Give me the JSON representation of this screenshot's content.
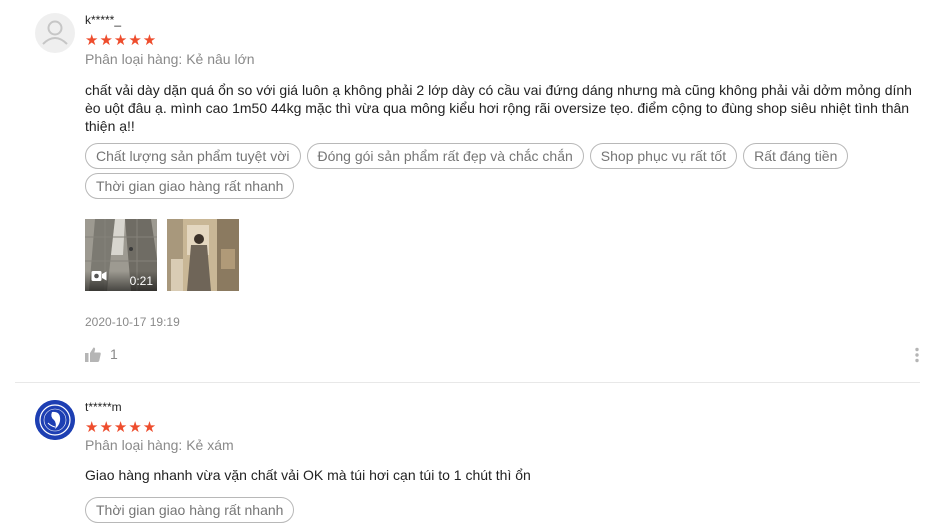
{
  "reviews": [
    {
      "username": "k*****_",
      "stars": "★★★★★",
      "variation": "Phân loại hàng: Kẻ nâu lớn",
      "comment": "chất vải dày dặn quá ổn so với giá luôn ạ không phải 2 lớp dày có cầu vai đứng dáng nhưng mà cũng không phải vải dởm mỏng dính èo uột đâu ạ. mình cao 1m50 44kg mặc thì vừa qua mông kiểu hơi rộng rãi oversize tẹo. điểm cộng to đùng shop siêu nhiệt tình thân thiện ạ!!",
      "tags": [
        "Chất lượng sản phẩm tuyệt vời",
        "Đóng gói sản phẩm rất đẹp và chắc chắn",
        "Shop phục vụ rất tốt",
        "Rất đáng tiền",
        "Thời gian giao hàng rất nhanh"
      ],
      "video_duration": "0:21",
      "time": "2020-10-17 19:19",
      "likes": "1",
      "avatar_icon": "default-user-icon"
    },
    {
      "username": "t*****m",
      "stars": "★★★★★",
      "variation": "Phân loại hàng: Kẻ xám",
      "comment": "Giao hàng nhanh vừa vặn chất vải OK mà túi hơi cạn túi to 1 chút thì ổn",
      "tags": [
        "Thời gian giao hàng rất nhanh"
      ],
      "avatar_icon": "brand-logo-avatar"
    }
  ],
  "icons": {
    "like": "thumbs-up-icon",
    "more": "more-vertical-icon",
    "video": "video-camera-icon"
  },
  "colors": {
    "star": "#ee4d2d",
    "muted": "#8a8a8a",
    "tag_border": "#b8b8b8",
    "divider": "#e8e8e8",
    "brand_avatar": "#1d3fb3"
  }
}
